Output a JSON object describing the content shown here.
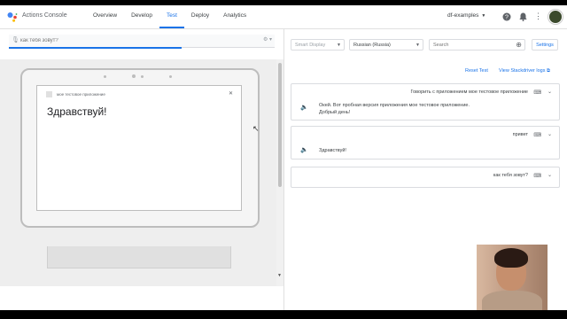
{
  "app": {
    "title": "Actions Console",
    "project": "df-examples"
  },
  "nav": {
    "tabs": [
      "Overview",
      "Develop",
      "Test",
      "Deploy",
      "Analytics"
    ],
    "active": "Test"
  },
  "simulator": {
    "input_placeholder": "как тебя зовут?",
    "device": {
      "app_name": "мое тестовое приложение",
      "display_text": "Здравствуй!"
    }
  },
  "toolbar": {
    "surface": "Smart Display",
    "language": "Russian (Russia)",
    "search_placeholder": "Search",
    "settings_label": "Settings"
  },
  "links": {
    "reset": "Reset Test",
    "stackdriver": "View Stackdriver logs"
  },
  "conversation": [
    {
      "request": "Говорить с приложением мое тестовое приложение",
      "response": [
        "Окей. Вот пробная версия приложения мое тестовое приложение.",
        "Добрый день!"
      ]
    },
    {
      "request": "привет",
      "response": [
        "Здравствуй!"
      ]
    },
    {
      "request": "как тебя зовут?",
      "response": []
    }
  ],
  "colors": {
    "accent": "#1a73e8",
    "border": "#dadce0",
    "preview_bg": "#eeeeee"
  }
}
